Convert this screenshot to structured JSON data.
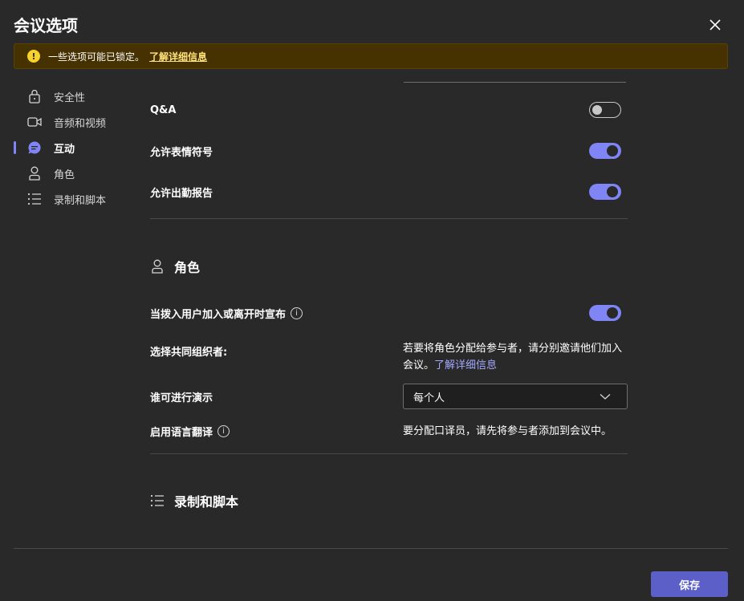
{
  "dialog": {
    "title": "会议选项",
    "close_icon": "close-icon"
  },
  "banner": {
    "icon": "warning-icon",
    "text": "一些选项可能已锁定。",
    "link": "了解详细信息"
  },
  "sidebar": {
    "items": [
      {
        "label": "安全性",
        "icon": "lock-icon",
        "active": false
      },
      {
        "label": "音频和视频",
        "icon": "video-icon",
        "active": false
      },
      {
        "label": "互动",
        "icon": "chat-icon",
        "active": true
      },
      {
        "label": "角色",
        "icon": "person-icon",
        "active": false
      },
      {
        "label": "录制和脚本",
        "icon": "list-icon",
        "active": false
      }
    ]
  },
  "interaction": {
    "qa_label": "Q&A",
    "qa_on": false,
    "reactions_label": "允许表情符号",
    "reactions_on": true,
    "attendance_label": "允许出勤报告",
    "attendance_on": true
  },
  "roles": {
    "heading": "角色",
    "announce_label": "当拨入用户加入或离开时宣布",
    "announce_on": true,
    "coorganizer_label": "选择共同组织者:",
    "coorganizer_text": "若要将角色分配给参与者，请分别邀请他们加入会议。",
    "coorganizer_link": "了解详细信息",
    "presenter_label": "谁可进行演示",
    "presenter_value": "每个人",
    "translation_label": "启用语言翻译",
    "translation_text": "要分配口译员，请先将参与者添加到会议中。"
  },
  "recording": {
    "heading": "录制和脚本"
  },
  "footer": {
    "save_label": "保存"
  },
  "colors": {
    "accent": "#7f85f5",
    "button": "#5b5fc7",
    "banner_bg": "#463100",
    "background": "#292929"
  }
}
